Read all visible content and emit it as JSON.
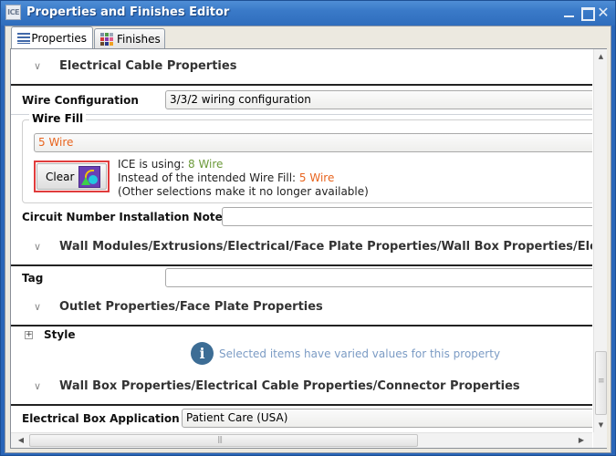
{
  "window": {
    "title": "Properties and Finishes Editor",
    "app_icon_label": "ICE",
    "controls": {
      "minimize": "minimize",
      "maximize": "maximize",
      "close": "✕"
    }
  },
  "tabs": [
    {
      "label": "Properties",
      "icon": "list-icon",
      "active": true
    },
    {
      "label": "Finishes",
      "icon": "color-grid-icon",
      "active": false
    }
  ],
  "sections": [
    {
      "title": "Electrical Cable Properties",
      "expanded": true,
      "properties": {
        "wire_configuration": {
          "label": "Wire Configuration",
          "value": "3/3/2 wiring configuration"
        },
        "wire_fill": {
          "label": "Wire Fill",
          "value": "5 Wire",
          "clear_button": "Clear",
          "message": {
            "line1_prefix": "ICE is using: ",
            "line1_value": "8 Wire",
            "line2_prefix": "Instead of the intended Wire Fill: ",
            "line2_value": "5 Wire",
            "line3": "(Other selections make it no longer available)"
          }
        },
        "circuit_note": {
          "label": "Circuit Number Installation Note",
          "value": ""
        }
      }
    },
    {
      "title": "Wall Modules/Extrusions/Electrical/Face Plate Properties/Wall Box Properties/Electrical",
      "expanded": true,
      "properties": {
        "tag": {
          "label": "Tag",
          "value": ""
        }
      }
    },
    {
      "title": "Outlet Properties/Face Plate Properties",
      "expanded": true,
      "properties": {
        "style": {
          "label": "Style",
          "expander": "+",
          "info": "Selected items have varied values for this property"
        }
      }
    },
    {
      "title": "Wall Box Properties/Electrical Cable Properties/Connector Properties",
      "expanded": true,
      "properties": {
        "box_application": {
          "label": "Electrical Box Application",
          "value": "Patient Care (USA)"
        }
      }
    }
  ],
  "glyphs": {
    "chevron": "∨",
    "info": "i",
    "scroll_up": "▲",
    "scroll_down": "▼",
    "scroll_left": "◀",
    "scroll_right": "▶"
  },
  "colors": {
    "titlebar": "#3a7ac8",
    "accent_orange": "#e8641e",
    "accent_green": "#6c9a3a",
    "info_blue": "#3d6d95",
    "highlight_red": "#e03c3c"
  }
}
